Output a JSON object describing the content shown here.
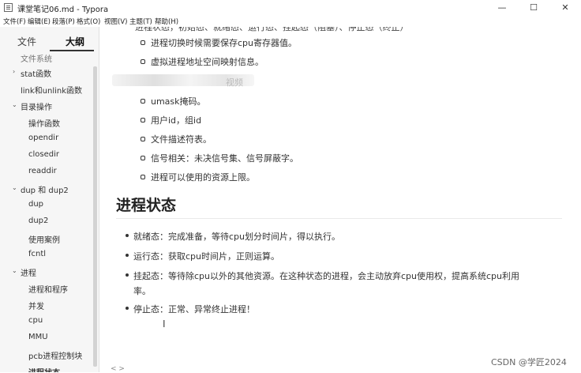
{
  "window": {
    "title": "课堂笔记06.md - Typora",
    "minimize_symbol": "—",
    "maximize_symbol": "☐",
    "close_symbol": "✕",
    "icons": [
      "typora-app-icon"
    ]
  },
  "menubar": [
    "文件(F)",
    "编辑(E)",
    "段落(P)",
    "格式(O)",
    "视图(V)",
    "主题(T)",
    "帮助(H)"
  ],
  "sidebar": {
    "tabs": [
      {
        "label": "文件",
        "active": false
      },
      {
        "label": "大纲",
        "active": true
      }
    ],
    "cut_item": "文件系统",
    "items": [
      {
        "label": "stat函数",
        "level": 1,
        "collapsible": true,
        "expanded": false
      },
      {
        "label": "link和unlink函数",
        "level": 1,
        "collapsible": false
      },
      {
        "label": "目录操作",
        "level": 1,
        "collapsible": true,
        "expanded": true
      },
      {
        "label": "操作函数",
        "level": 2
      },
      {
        "label": "opendir",
        "level": 2
      },
      {
        "label": "closedir",
        "level": 2
      },
      {
        "label": "readdir",
        "level": 2
      },
      {
        "label": "dup 和 dup2",
        "level": 1,
        "collapsible": true,
        "expanded": true
      },
      {
        "label": "dup",
        "level": 2
      },
      {
        "label": "dup2",
        "level": 2
      },
      {
        "label": "使用案例",
        "level": 2
      },
      {
        "label": "fcntl",
        "level": 2
      },
      {
        "label": "进程",
        "level": 1,
        "collapsible": true,
        "expanded": true
      },
      {
        "label": "进程和程序",
        "level": 2
      },
      {
        "label": "并发",
        "level": 2
      },
      {
        "label": "cpu",
        "level": 2
      },
      {
        "label": "MMU",
        "level": 2
      },
      {
        "label": "pcb进程控制块",
        "level": 2
      },
      {
        "label": "进程状态",
        "level": 2,
        "cut": true
      }
    ]
  },
  "editor": {
    "top_cut_line": "进程状态，初始态、就绪态、运行态、挂起态（阻塞）、停止态（终止）",
    "sub_bullets_1": [
      "进程切换时候需要保存cpu寄存器值。",
      "虚拟进程地址空间映射信息。"
    ],
    "blurred_line": "视频",
    "sub_bullets_2": [
      "umask掩码。",
      "用户id，组id",
      "文件描述符表。",
      "信号相关：未决信号集、信号屏蔽字。",
      "进程可以使用的资源上限。"
    ],
    "heading": "进程状态",
    "state_bullets": [
      "就绪态：完成准备，等待cpu划分时间片，得以执行。",
      "运行态：获取cpu时间片，正则运算。",
      "挂起态：等待除cpu以外的其他资源。在这种状态的进程，会主动放弃cpu使用权，提高系统cpu利用",
      "率。",
      "停止态：正常、异常终止进程！"
    ],
    "cursor": "I",
    "corner_mark": "< >"
  },
  "watermark": "CSDN @学匠2024"
}
